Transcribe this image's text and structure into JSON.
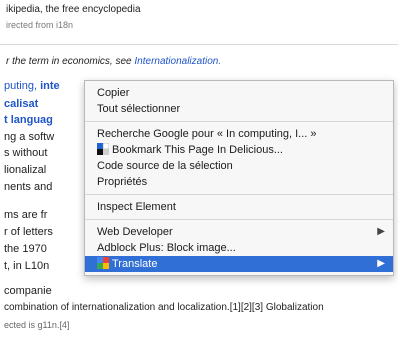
{
  "article": {
    "site_line": "ikipedia, the free encyclopedia",
    "redirect_line": "irected from i18n",
    "hatnote_prefix": "r the term in economics, see ",
    "hatnote_link": "Internationalization.",
    "intro_start": "puting, ",
    "intro_bold": "inte",
    "line_cut1": "calisat",
    "line_cut2": "t languag",
    "line_cut3": "ng a softw",
    "line_cut4": "s without",
    "line_cut5": "lionalizal",
    "line_cut6": "nents and",
    "line_cut7": "ms are fr",
    "line_cut8": "r of letters",
    "line_cut9": "the 1970",
    "line_cut10": "t, in L10n",
    "line_cut11": "companie",
    "bottom_line": "combination of internationalization and localization.[1][2][3] Globalization",
    "bottom_line2": "ected is g11n.[4]"
  },
  "context_menu": {
    "items": [
      {
        "label": "Copier"
      },
      {
        "label": "Tout sélectionner"
      },
      {
        "label": "Recherche Google pour « In computing, I... »"
      },
      {
        "label": "Bookmark This Page In Delicious..."
      },
      {
        "label": "Code source de la sélection"
      },
      {
        "label": "Propriétés"
      },
      {
        "label": "Inspect Element"
      },
      {
        "label": "Web Developer"
      },
      {
        "label": "Adblock Plus: Block image..."
      },
      {
        "label": "Translate"
      }
    ]
  },
  "icons": {
    "delicious": "delicious-icon",
    "translate": "google-translate-icon",
    "submenu": "submenu-arrow-icon"
  },
  "colors": {
    "highlight": "#2f6fd6",
    "link": "#1f55c8"
  }
}
